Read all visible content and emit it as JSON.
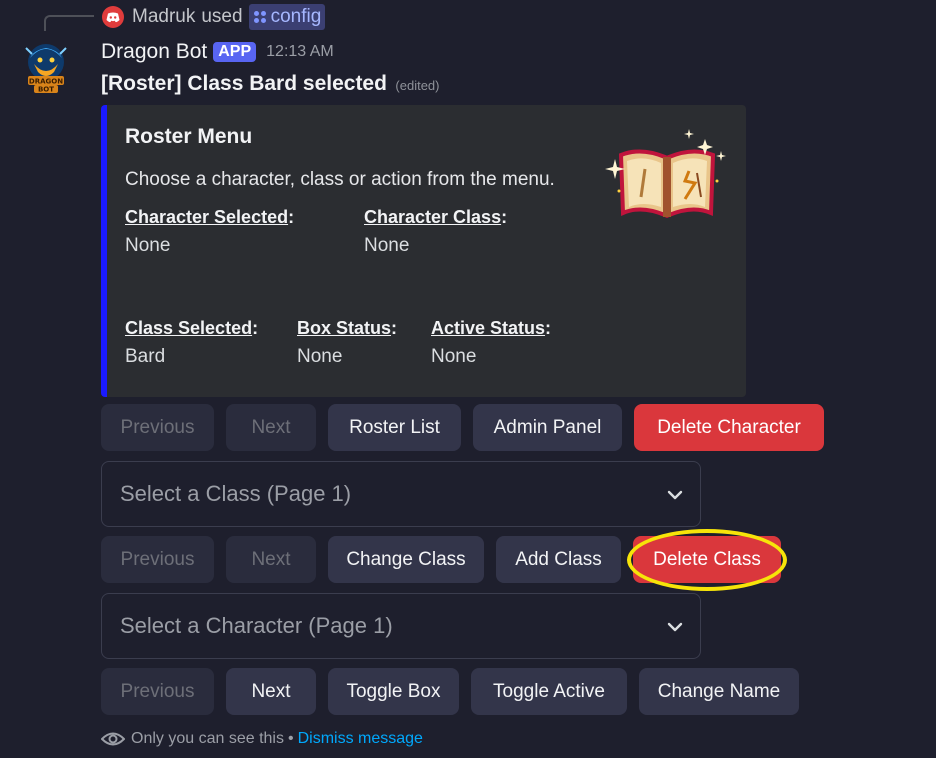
{
  "reply": {
    "user": "Madruk",
    "used_text": "used",
    "command": "config"
  },
  "header": {
    "bot_name": "Dragon Bot",
    "badge": "APP",
    "timestamp": "12:13 AM"
  },
  "message": {
    "title": "[Roster] Class Bard selected",
    "edited": "(edited)"
  },
  "embed": {
    "accent_color": "#1a1aff",
    "title": "Roster Menu",
    "description": "Choose a character, class or action from the menu.",
    "fields": [
      {
        "name": "Character Selected",
        "value": "None"
      },
      {
        "name": "Character Class",
        "value": "None"
      },
      {
        "name": "Class Selected",
        "value": "Bard"
      },
      {
        "name": "Box Status",
        "value": "None"
      },
      {
        "name": "Active Status",
        "value": "None"
      }
    ],
    "thumbnail": "spellbook-image"
  },
  "rows": {
    "row1": [
      "Previous",
      "Next",
      "Roster List",
      "Admin Panel",
      "Delete Character"
    ],
    "select_class": "Select a Class (Page 1)",
    "row2": [
      "Previous",
      "Next",
      "Change Class",
      "Add Class",
      "Delete Class"
    ],
    "select_character": "Select a Character (Page 1)",
    "row3": [
      "Previous",
      "Next",
      "Toggle Box",
      "Toggle Active",
      "Change Name"
    ]
  },
  "footer": {
    "visibility": "Only you can see this",
    "separator": "•",
    "dismiss": "Dismiss message"
  },
  "colors": {
    "background": "#1e1f2d",
    "danger": "#da373c",
    "highlight": "#f7e409",
    "link": "#00a8fc"
  }
}
